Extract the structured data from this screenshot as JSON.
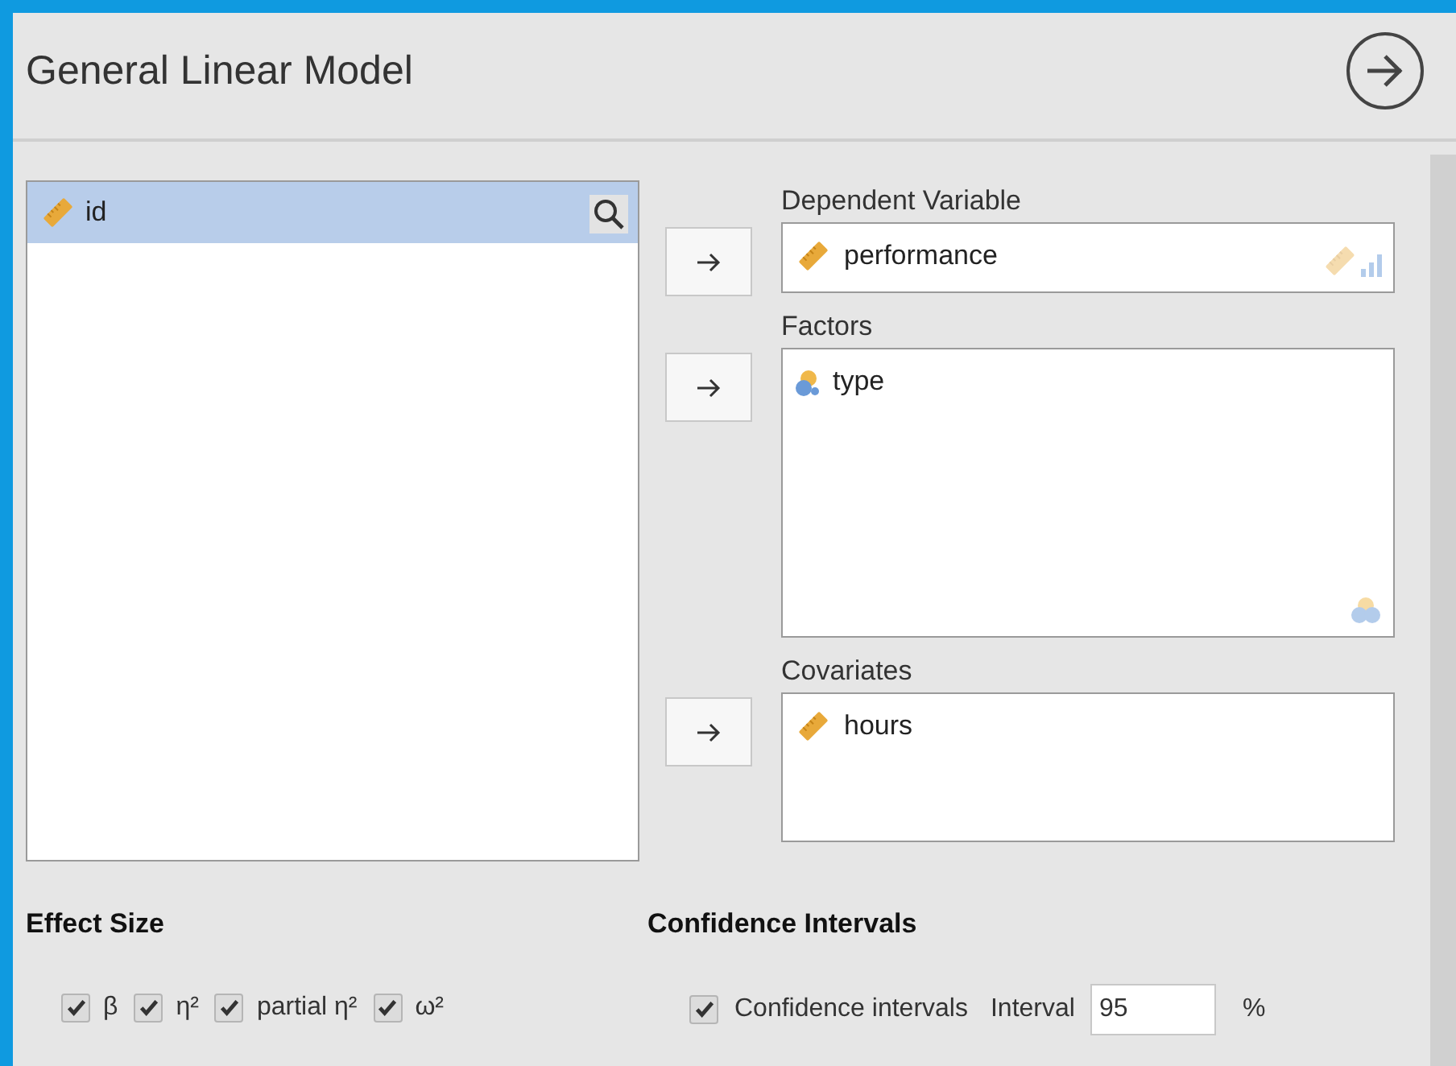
{
  "title": "General Linear Model",
  "variables": [
    {
      "name": "id",
      "kind": "scale",
      "selected": true
    }
  ],
  "targets": [
    {
      "label": "Dependent Variable",
      "items": [
        {
          "name": "performance",
          "kind": "scale"
        }
      ]
    },
    {
      "label": "Factors",
      "items": [
        {
          "name": "type",
          "kind": "nominal"
        }
      ]
    },
    {
      "label": "Covariates",
      "items": [
        {
          "name": "hours",
          "kind": "scale"
        }
      ]
    }
  ],
  "effect_size": {
    "title": "Effect Size",
    "options": [
      {
        "label": "β",
        "checked": true
      },
      {
        "label": "η²",
        "checked": true
      },
      {
        "label": "partial η²",
        "checked": true
      },
      {
        "label": "ω²",
        "checked": true
      }
    ]
  },
  "confidence": {
    "title": "Confidence Intervals",
    "option": {
      "label": "Confidence intervals",
      "checked": true
    },
    "interval_label": "Interval",
    "interval_value": "95",
    "unit": "%"
  }
}
